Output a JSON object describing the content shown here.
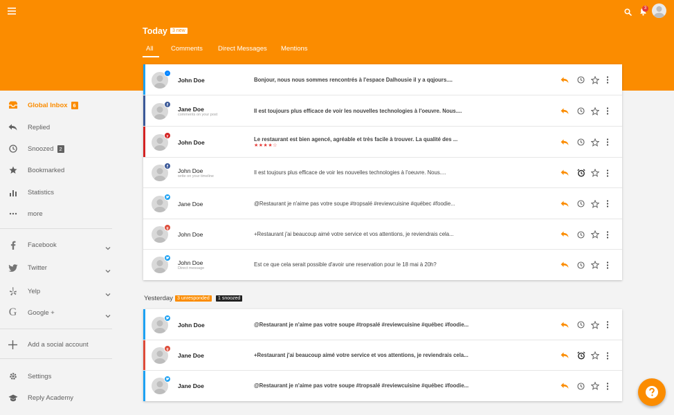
{
  "colors": {
    "brand": "#fb8c00",
    "facebook": "#3b5998",
    "yelp": "#d32323",
    "twitter": "#1da1f2",
    "google": "#dd4b39",
    "messenger": "#0084ff"
  },
  "topbar": {
    "notifications_count": "3"
  },
  "today": {
    "title": "Today",
    "badge": "3 new",
    "tabs": [
      "All",
      "Comments",
      "Direct Messages",
      "Mentions"
    ]
  },
  "sidebar": {
    "global_inbox": {
      "label": "Global Inbox",
      "count": "6"
    },
    "items": [
      {
        "label": "Replied",
        "icon": "reply-icon"
      },
      {
        "label": "Snoozed",
        "count": "2",
        "icon": "clock-icon"
      },
      {
        "label": "Bookmarked",
        "icon": "star-icon"
      },
      {
        "label": "Statistics",
        "icon": "bar-chart-icon"
      },
      {
        "label": "more",
        "icon": "more-horizontal-icon"
      }
    ],
    "networks": [
      {
        "label": "Facebook",
        "icon": "facebook-icon"
      },
      {
        "label": "Twitter",
        "icon": "twitter-icon"
      },
      {
        "label": "Yelp",
        "icon": "yelp-icon"
      },
      {
        "label": "Google +",
        "icon": "google-icon"
      }
    ],
    "add_account": "Add a social account",
    "settings": "Settings",
    "academy": "Reply Academy"
  },
  "today_rows": [
    {
      "name": "John Doe",
      "sub": "",
      "message": "Bonjour, nous nous sommes rencontrés à l'espace Dalhousie il y a qqjours....",
      "network": "messenger",
      "unread": true,
      "snooze": "clock"
    },
    {
      "name": "Jane Doe",
      "sub": "comments on your post",
      "message": "Il est toujours plus efficace de voir les nouvelles technologies à l'oeuvre. Nous....",
      "network": "facebook",
      "unread": true,
      "snooze": "clock"
    },
    {
      "name": "John Doe",
      "sub": "",
      "message": "Le restaurant est bien agencé, agréable et très facile à trouver. La qualité des ...",
      "stars": "★★★★☆",
      "rating": 4,
      "network": "yelp",
      "unread": true,
      "snooze": "clock"
    },
    {
      "name": "John Doe",
      "sub": "write on your timeline",
      "message": "Il est toujours plus efficace de voir les nouvelles technologies à l'oeuvre. Nous....",
      "network": "facebook",
      "unread": false,
      "snooze": "alarm"
    },
    {
      "name": "Jane Doe",
      "sub": "",
      "message": "@Restaurant je n'aime pas votre soupe #tropsalé #reviewcuisine #québec #foodie...",
      "network": "twitter",
      "unread": false,
      "snooze": "clock"
    },
    {
      "name": "John Doe",
      "sub": "",
      "message": "+Restaurant j'ai beaucoup aimé votre service et vos attentions, je reviendrais cela...",
      "network": "google",
      "unread": false,
      "snooze": "clock"
    },
    {
      "name": "John Doe",
      "sub": "Direct message",
      "message": "Est ce que cela serait possible d'avoir une reservation pour le 18 mai à 20h?",
      "network": "twitter",
      "unread": false,
      "snooze": "clock"
    }
  ],
  "yesterday": {
    "title": "Yesterday",
    "unresponded": "3 unresponded",
    "snoozed": "1 snoozed"
  },
  "yesterday_rows": [
    {
      "name": "John Doe",
      "sub": "",
      "message": "@Restaurant je n'aime pas votre soupe #tropsalé #reviewcuisine #québec #foodie...",
      "network": "twitter",
      "unread": true,
      "snooze": "clock"
    },
    {
      "name": "Jane Doe",
      "sub": "",
      "message": "+Restaurant j'ai beaucoup aimé votre service et vos attentions, je reviendrais cela...",
      "network": "google",
      "unread": true,
      "snooze": "alarm"
    },
    {
      "name": "Jane Doe",
      "sub": "",
      "message": "@Restaurant je n'aime pas votre soupe #tropsalé #reviewcuisine #québec #foodie...",
      "network": "twitter",
      "unread": true,
      "snooze": "clock"
    }
  ]
}
